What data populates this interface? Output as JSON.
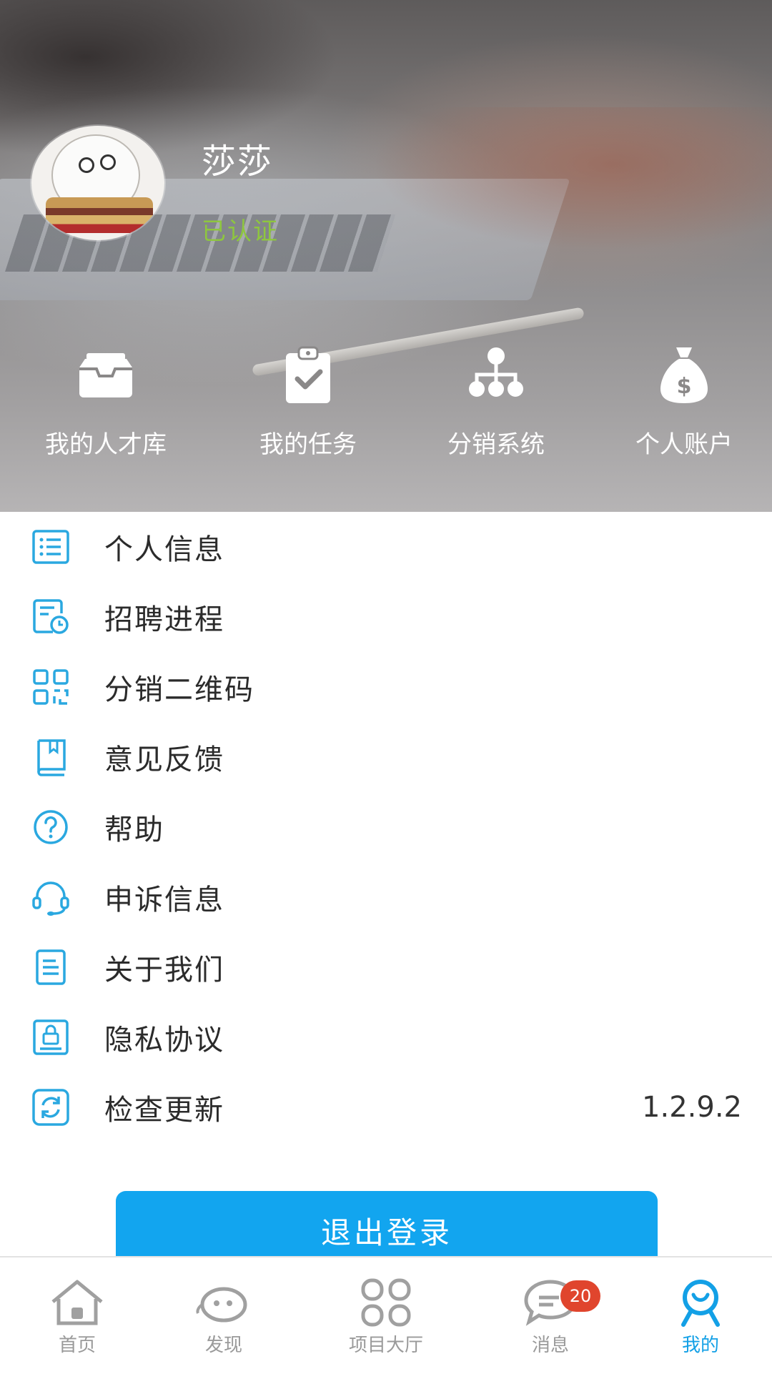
{
  "profile": {
    "name": "莎莎",
    "status": "已认证"
  },
  "quick_actions": [
    {
      "label": "我的人才库",
      "icon": "inbox-icon"
    },
    {
      "label": "我的任务",
      "icon": "clipboard-check-icon"
    },
    {
      "label": "分销系统",
      "icon": "hierarchy-icon"
    },
    {
      "label": "个人账户",
      "icon": "money-bag-icon"
    }
  ],
  "menu": [
    {
      "label": "个人信息",
      "icon": "list-icon"
    },
    {
      "label": "招聘进程",
      "icon": "document-clock-icon"
    },
    {
      "label": "分销二维码",
      "icon": "qr-code-icon"
    },
    {
      "label": "意见反馈",
      "icon": "book-icon"
    },
    {
      "label": "帮助",
      "icon": "help-icon"
    },
    {
      "label": "申诉信息",
      "icon": "headset-icon"
    },
    {
      "label": "关于我们",
      "icon": "document-icon"
    },
    {
      "label": "隐私协议",
      "icon": "lock-document-icon"
    },
    {
      "label": "检查更新",
      "icon": "refresh-icon",
      "value": "1.2.9.2"
    }
  ],
  "logout_label": "退出登录",
  "tabs": [
    {
      "label": "首页",
      "icon": "home-icon"
    },
    {
      "label": "发现",
      "icon": "discover-icon"
    },
    {
      "label": "项目大厅",
      "icon": "grid-icon"
    },
    {
      "label": "消息",
      "icon": "message-icon",
      "badge": "20"
    },
    {
      "label": "我的",
      "icon": "profile-icon",
      "active": true
    }
  ],
  "colors": {
    "accent": "#12a5ef",
    "icon_blue": "#2aa8e0",
    "verified_green": "#8ec63f",
    "badge_red": "#e0452d"
  }
}
